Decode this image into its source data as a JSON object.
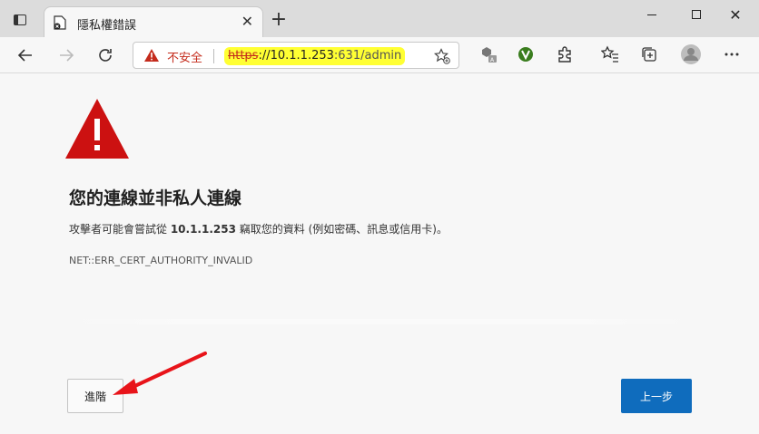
{
  "tab": {
    "title": "隱私權錯誤",
    "close_label": "✕",
    "new_tab_label": "+"
  },
  "window": {
    "close_label": "✕"
  },
  "addressbar": {
    "security_label": "不安全",
    "url_scheme": "https",
    "url_host": "://10.1.1.253",
    "url_rest": ":631/admin"
  },
  "page": {
    "heading": "您的連線並非私人連線",
    "desc_prefix": "攻擊者可能會嘗試從 ",
    "desc_host": "10.1.1.253",
    "desc_suffix": " 竊取您的資料 (例如密碼、訊息或信用卡)。",
    "error_code": "NET::ERR_CERT_AUTHORITY_INVALID",
    "advanced_label": "進階",
    "back_label": "上一步"
  },
  "colors": {
    "warning_red": "#cc1111",
    "primary_blue": "#0f6cbd",
    "url_highlight": "#ffff33",
    "annotation_arrow": "#e8141a"
  },
  "icons": [
    "tab-actions-icon",
    "page-favicon-icon",
    "back-arrow-icon",
    "forward-arrow-icon",
    "reload-icon",
    "not-secure-warning-icon",
    "favorite-star-icon",
    "read-aloud-icon",
    "extension-icon",
    "puzzle-extensions-icon",
    "favorites-icon",
    "collections-icon",
    "profile-avatar-icon",
    "more-menu-icon",
    "warning-triangle-icon"
  ]
}
